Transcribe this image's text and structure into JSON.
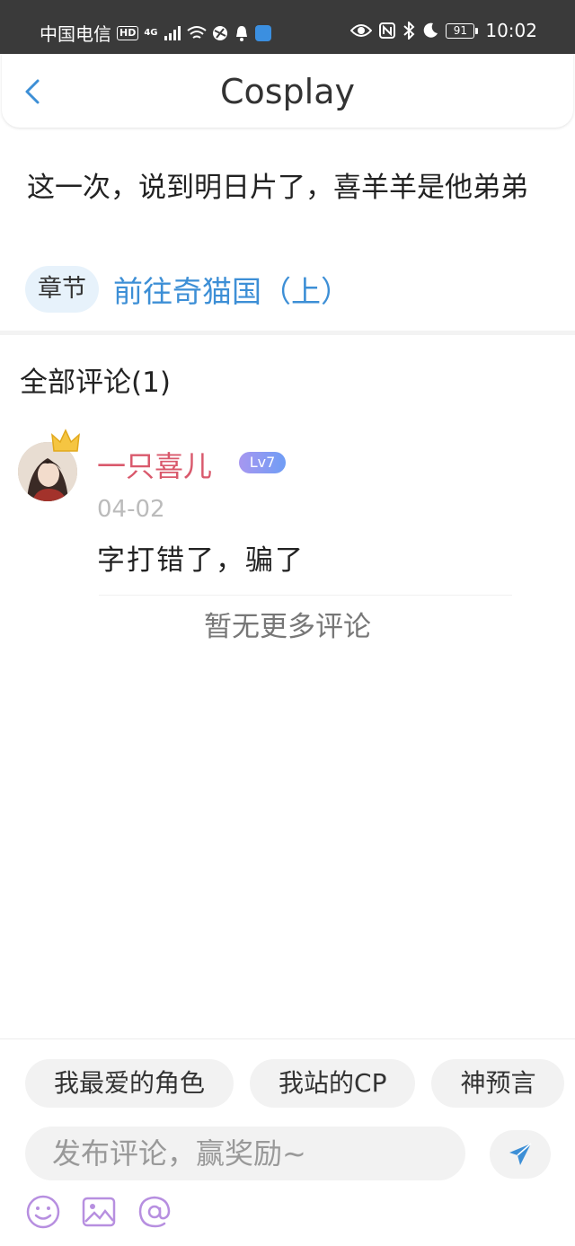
{
  "status_bar": {
    "carrier": "中国电信",
    "hd": "HD",
    "network": "4G",
    "battery": "91",
    "time": "10:02"
  },
  "header": {
    "title": "Cosplay"
  },
  "post": {
    "text": "这一次，说到明日片了，喜羊羊是他弟弟",
    "chapter_tag": "章节",
    "chapter_link": "前往奇猫国（上）"
  },
  "comments_section": {
    "title": "全部评论(1)",
    "comments": [
      {
        "user": "一只喜儿",
        "level": "Lv7",
        "date": "04-02",
        "text": "字打错了，骗了"
      }
    ],
    "no_more": "暂无更多评论"
  },
  "composer": {
    "chips": [
      "我最爱的角色",
      "我站的CP",
      "神预言"
    ],
    "placeholder": "发布评论，赢奖励~"
  },
  "colors": {
    "accent_blue": "#3d8fd6",
    "username_red": "#d9596c",
    "icon_purple": "#b78fe0"
  }
}
